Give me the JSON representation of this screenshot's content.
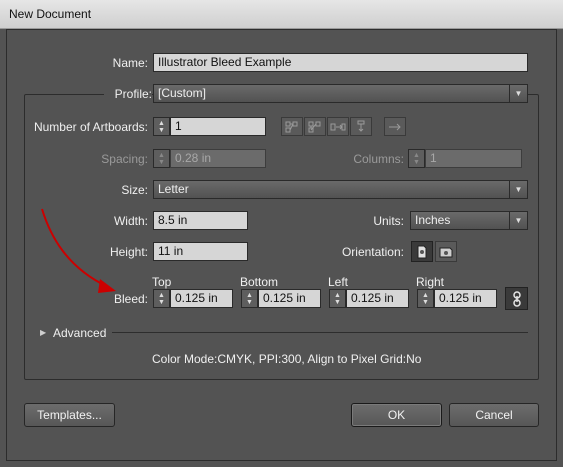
{
  "window": {
    "title": "New Document"
  },
  "name": {
    "label": "Name:",
    "value": "Illustrator Bleed Example"
  },
  "profile": {
    "label": "Profile:",
    "value": "[Custom]"
  },
  "artboards": {
    "label": "Number of Artboards:",
    "value": "1"
  },
  "spacing": {
    "label": "Spacing:",
    "value": "0.28 in"
  },
  "columns": {
    "label": "Columns:",
    "value": "1"
  },
  "size": {
    "label": "Size:",
    "value": "Letter"
  },
  "width": {
    "label": "Width:",
    "value": "8.5 in"
  },
  "units": {
    "label": "Units:",
    "value": "Inches"
  },
  "height": {
    "label": "Height:",
    "value": "11 in"
  },
  "orientation": {
    "label": "Orientation:"
  },
  "bleed": {
    "label": "Bleed:",
    "top": {
      "label": "Top",
      "value": "0.125 in"
    },
    "bottom": {
      "label": "Bottom",
      "value": "0.125 in"
    },
    "left": {
      "label": "Left",
      "value": "0.125 in"
    },
    "right": {
      "label": "Right",
      "value": "0.125 in"
    }
  },
  "advanced": {
    "label": "Advanced"
  },
  "summary": "Color Mode:CMYK, PPI:300, Align to Pixel Grid:No",
  "buttons": {
    "templates": "Templates...",
    "ok": "OK",
    "cancel": "Cancel"
  },
  "icons": {
    "close": "close-icon",
    "grid_by_row": "grid-by-row-icon",
    "grid_by_column": "grid-by-column-icon",
    "arrange_by_row": "arrange-by-row-icon",
    "arrange_by_column": "arrange-by-column-icon",
    "layout_direction": "layout-direction-arrow-icon",
    "portrait": "portrait-orientation-icon",
    "landscape": "landscape-orientation-icon",
    "link": "link-bleed-icon",
    "annotation_arrow": "red-annotation-arrow-icon"
  },
  "colors": {
    "dialog_bg": "#535353",
    "field_bg": "#d6d6d6",
    "annotation": "#cc0000"
  }
}
